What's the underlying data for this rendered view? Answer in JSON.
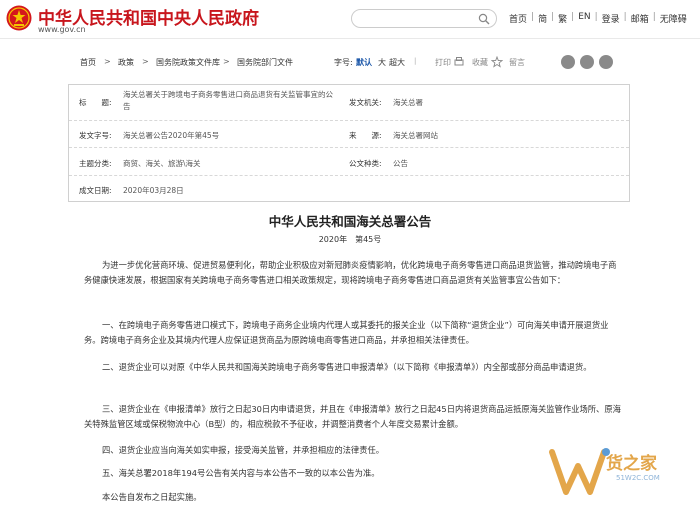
{
  "header": {
    "site_title": "中华人民共和国中央人民政府",
    "site_url": "www.gov.cn",
    "links": [
      "首页",
      "简",
      "繁",
      "EN",
      "登录",
      "邮箱",
      "无障碍"
    ]
  },
  "breadcrumb": {
    "items": [
      "首页",
      "政策",
      "国务院政策文件库",
      "国务院部门文件"
    ],
    "font_label": "字号:",
    "font_default": "默认",
    "font_big": "大",
    "font_bigger": "超大",
    "print": "打印",
    "favorite": "收藏",
    "comment": "留言"
  },
  "info": {
    "title_label": "标　　题:",
    "title_value": "海关总署关于跨境电子商务零售进口商品退货有关监管事宜的公告",
    "issuer_label": "发文机关:",
    "issuer_value": "海关总署",
    "docno_label": "发文字号:",
    "docno_value": "海关总署公告2020年第45号",
    "source_label": "来　　源:",
    "source_value": "海关总署网站",
    "topic_label": "主题分类:",
    "topic_value": "商贸、海关、旅游\\海关",
    "type_label": "公文种类:",
    "type_value": "公告",
    "date_label": "成文日期:",
    "date_value": "2020年03月28日"
  },
  "article": {
    "title": "中华人民共和国海关总署公告",
    "number": "2020年　第45号",
    "paragraphs": [
      "为进一步优化营商环境、促进贸易便利化，帮助企业积极应对新冠肺炎疫情影响，优化跨境电子商务零售进口商品退货监管，推动跨境电子商务健康快速发展，根据国家有关跨境电子商务零售进口相关政策规定，现将跨境电子商务零售进口商品退货有关监管事宜公告如下：",
      "一、在跨境电子商务零售进口模式下，跨境电子商务企业境内代理人或其委托的报关企业（以下简称“退货企业”）可向海关申请开展退货业务。跨境电子商务企业及其境内代理人应保证退货商品为原跨境电商零售进口商品，并承担相关法律责任。",
      "二、退货企业可以对原《中华人民共和国海关跨境电子商务零售进口申报清单》（以下简称《申报清单》）内全部或部分商品申请退货。",
      "三、退货企业在《申报清单》放行之日起30日内申请退货，并且在《申报清单》放行之日起45日内将退货商品运抵原海关监管作业场所、原海关特殊监管区域或保税物流中心（B型）的，相应税款不予征收，并调整消费者个人年度交易累计金额。",
      "四、退货企业应当向海关如实申报，接受海关监管，并承担相应的法律责任。",
      "五、海关总署2018年194号公告有关内容与本公告不一致的以本公告为准。",
      "本公告自发布之日起实施。"
    ]
  },
  "watermark": {
    "text": "货之家",
    "sub": "51W2C.COM"
  },
  "colors": {
    "brand_red": "#c8161d",
    "watermark_orange": "#e3a64a"
  }
}
